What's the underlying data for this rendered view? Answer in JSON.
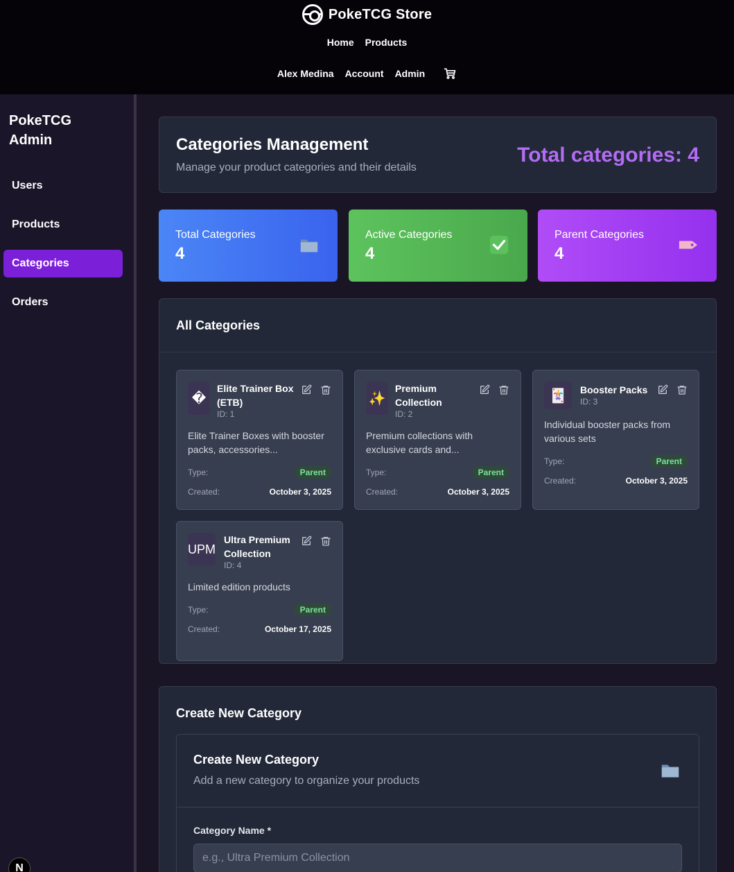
{
  "header": {
    "brand": "PokeTCG Store",
    "nav": [
      "Home",
      "Products"
    ],
    "user_nav": [
      "Alex Medina",
      "Account",
      "Admin"
    ]
  },
  "sidebar": {
    "title": "PokeTCG Admin",
    "items": [
      {
        "label": "Users",
        "active": false
      },
      {
        "label": "Products",
        "active": false
      },
      {
        "label": "Categories",
        "active": true
      },
      {
        "label": "Orders",
        "active": false
      }
    ],
    "badge": "N"
  },
  "page": {
    "title": "Categories Management",
    "subtitle": "Manage your product categories and their details",
    "total": "Total categories: 4"
  },
  "stats": [
    {
      "label": "Total Categories",
      "value": "4",
      "icon": "folder-icon",
      "color": "#3a63ee"
    },
    {
      "label": "Active Categories",
      "value": "4",
      "icon": "check-icon",
      "color": "#4aa84c"
    },
    {
      "label": "Parent Categories",
      "value": "4",
      "icon": "tag-icon",
      "color": "#9431ee"
    }
  ],
  "all": {
    "title": "All Categories",
    "type_label": "Type:",
    "created_label": "Created:",
    "cards": [
      {
        "icon": "�",
        "name": "Elite Trainer Box (ETB)",
        "id": "ID: 1",
        "desc": "Elite Trainer Boxes with booster packs, accessories...",
        "type": "Parent",
        "created": "October 3, 2025"
      },
      {
        "icon": "✨",
        "name": "Premium Collection",
        "id": "ID: 2",
        "desc": "Premium collections with exclusive cards and...",
        "type": "Parent",
        "created": "October 3, 2025"
      },
      {
        "icon": "🃏",
        "name": "Booster Packs",
        "id": "ID: 3",
        "desc": "Individual booster packs from various sets",
        "type": "Parent",
        "created": "October 3, 2025"
      },
      {
        "icon": "UPM",
        "name": "Ultra Premium Collection",
        "id": "ID: 4",
        "desc": "Limited edition products",
        "type": "Parent",
        "created": "October 17, 2025"
      }
    ]
  },
  "create": {
    "section_title": "Create New Category",
    "title": "Create New Category",
    "subtitle": "Add a new category to organize your products",
    "name_label": "Category Name *",
    "name_placeholder": "e.g., Ultra Premium Collection"
  }
}
